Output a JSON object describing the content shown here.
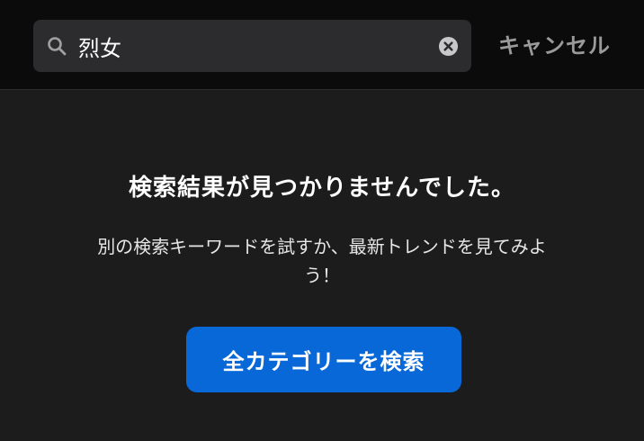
{
  "search": {
    "value": "烈女",
    "placeholder": ""
  },
  "header": {
    "cancel_label": "キャンセル"
  },
  "empty_state": {
    "title": "検索結果が見つかりませんでした。",
    "description": "別の検索キーワードを試すか、最新トレンドを見てみよう！",
    "button_label": "全カテゴリーを検索"
  },
  "icons": {
    "search": "search-icon",
    "clear": "clear-icon"
  },
  "colors": {
    "accent": "#0868d8",
    "background": "#1c1c1c",
    "header_background": "#0b0b0b",
    "input_background": "#2c2c2e",
    "cancel_text": "#9a9a9a"
  }
}
